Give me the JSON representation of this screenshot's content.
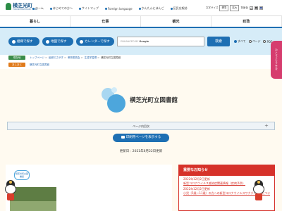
{
  "header": {
    "logo_text": "横芝光町",
    "logo_sub": "YOKOSHIBAHIKARI TOWN",
    "top_links": [
      "ホーム",
      "はじめての方へ",
      "サイトマップ",
      "Foreign language",
      "かんたんにほんご",
      "区民広報誌"
    ],
    "font_size_label": "文字サイズ",
    "font_std": "標準",
    "font_large": "拡大",
    "bg_color_label": "背景色",
    "bg_white": "白",
    "bg_black": "黒",
    "bg_blue": "青"
  },
  "nav": {
    "items": [
      "暮らし",
      "仕事",
      "観光",
      "町政"
    ]
  },
  "search": {
    "by_org": "組織で探す",
    "by_map": "地図で探す",
    "by_calendar": "カレンダーで探す",
    "google_enhanced": "ENHANCED BY",
    "google_brand": "Google",
    "search_button": "検索",
    "scope_all": "すべて",
    "scope_page": "ページ",
    "scope_pdf": "PDF"
  },
  "breadcrumb": {
    "current_label": "現在地",
    "items": [
      "トップページ",
      "組織でさがす",
      "教育委員会",
      "生涯学習課"
    ],
    "current": "横芝光町立図書館",
    "also_label": "あしあと",
    "also_link": "横芝光町立図書館"
  },
  "side_tab": {
    "label": "ひこうとうをを"
  },
  "page": {
    "title": "横芝光町立図書館",
    "contents_label": "ページ内目次",
    "contents_toggle": "＋",
    "print_button": "印刷用ページを表示する",
    "updated": "更新日：2021年6月22日更新"
  },
  "speech_bubble": "横芝光町立図書館",
  "news": {
    "heading": "重要なお知らせ",
    "items": [
      {
        "date": "2022年12月2日更新",
        "text": "新型コロナウイルス感染症関連情報（疾病予防）"
      },
      {
        "date": "2022年12月2日更新",
        "text": "小児（5歳～11歳）の方への新型コロナウイルスワクチン接種について（健康こども課）"
      }
    ]
  },
  "colors": {
    "accent_blue": "#1e6fb3",
    "accent_red": "#d6322a",
    "side_pink": "#d63c6e",
    "green": "#3a8c4a",
    "orange": "#e07a1a"
  }
}
